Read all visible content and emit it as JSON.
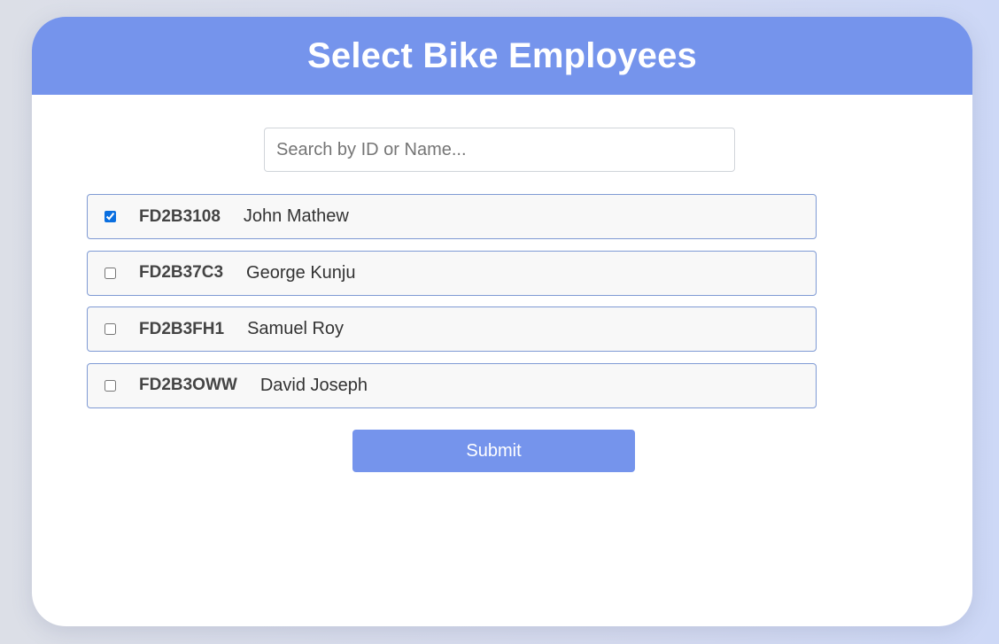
{
  "header": {
    "title": "Select Bike Employees"
  },
  "search": {
    "placeholder": "Search by ID or Name...",
    "value": ""
  },
  "employees": [
    {
      "id": "FD2B3108",
      "name": "John Mathew",
      "checked": true
    },
    {
      "id": "FD2B37C3",
      "name": "George Kunju",
      "checked": false
    },
    {
      "id": "FD2B3FH1",
      "name": "Samuel Roy",
      "checked": false
    },
    {
      "id": "FD2B3OWW",
      "name": "David Joseph",
      "checked": false
    }
  ],
  "actions": {
    "submit_label": "Submit"
  },
  "colors": {
    "accent": "#7594ec",
    "row_border": "#7f9ad4",
    "row_background": "#f8f8f8",
    "checkbox_checked": "#0a6fe0"
  }
}
